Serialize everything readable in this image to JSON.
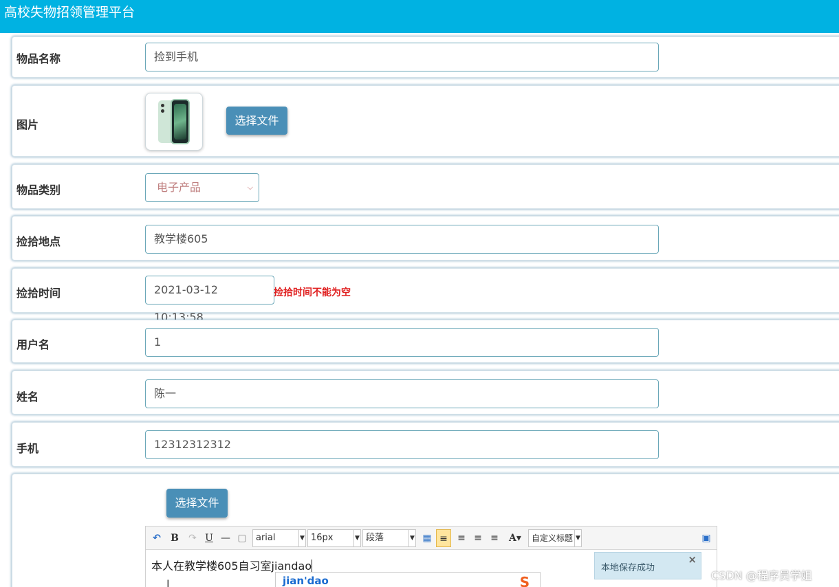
{
  "header": {
    "title": "高校失物招领管理平台"
  },
  "form": {
    "item_name": {
      "label": "物品名称",
      "value": "捡到手机"
    },
    "image": {
      "label": "图片",
      "choose_label": "选择文件"
    },
    "category": {
      "label": "物品类别",
      "value": "电子产品"
    },
    "location": {
      "label": "捡拾地点",
      "value": "教学楼605"
    },
    "time": {
      "label": "捡拾时间",
      "value": "2021-03-12 10:13:58",
      "error": "捡拾时间不能为空"
    },
    "username": {
      "label": "用户名",
      "value": "1"
    },
    "realname": {
      "label": "姓名",
      "value": "陈一"
    },
    "phone": {
      "label": "手机",
      "value": "12312312312"
    },
    "detail": {
      "choose_label": "选择文件"
    }
  },
  "editor": {
    "toolbar": {
      "undo_icon": "↶",
      "bold": "B",
      "redo_icon": "↷",
      "underline": "U",
      "hr": "—",
      "paste_icon": "▢",
      "font": "arial",
      "size": "16px",
      "paragraph": "段落",
      "title": "自定义标题"
    },
    "content": "本人在教学楼605自习室jiandao",
    "ime_pinyin": "jian'dao",
    "ime_logo": "S"
  },
  "toast": {
    "message": "本地保存成功",
    "close": "×"
  },
  "watermark": "CSDN @程序员学姐",
  "colors": {
    "header": "#00b2e2",
    "button": "#4a8fb7",
    "error": "#e02020"
  }
}
